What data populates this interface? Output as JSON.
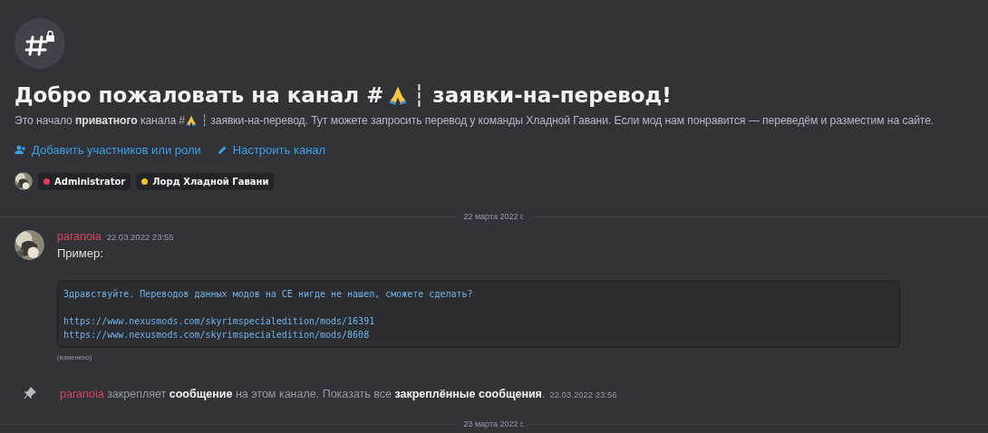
{
  "channel_intro": {
    "title_prefix": "Добро пожаловать на канал #",
    "title_suffix": "┆ заявки-на-перевод!",
    "description_prefix": "Это начало **приватного** канала #",
    "description_suffix": "┆ заявки-на-перевод. Тут можете запросить перевод у команды Хладной Гавани. Если мод нам понравится — переведём и разместим на сайте.",
    "actions": [
      {
        "kind": "members",
        "label": "Добавить участников или роли"
      },
      {
        "kind": "settings",
        "label": "Настроить канал"
      }
    ],
    "roles": [
      {
        "name": "Administrator",
        "color": "#e03b5f"
      },
      {
        "name": "Лорд Хладной Гавани",
        "color": "#f0c230"
      }
    ]
  },
  "messages": [
    {
      "kind": "divider",
      "date": "22 марта 2022 г."
    },
    {
      "kind": "message",
      "author": "paranoia",
      "timestamp": "22.03.2022 23:55",
      "text": "Пример:",
      "code": [
        [
          "Здравствуйте. Переводов данных модов на СЕ нигде не нашел, сможете сделать?"
        ],
        [
          "https://www.nexusmods.com/skyrimspecialedition/mods/16391",
          "https://www.nexusmods.com/skyrimspecialedition/mods/8608"
        ]
      ],
      "edited": "(изменено)"
    },
    {
      "kind": "pin",
      "author": "paranoia",
      "text": " закрепляет **сообщение** на этом канале. Показать все **закреплённые сообщения**.",
      "timestamp": "22.03.2022 23:56"
    },
    {
      "kind": "divider",
      "date": "23 марта 2022 г."
    }
  ]
}
